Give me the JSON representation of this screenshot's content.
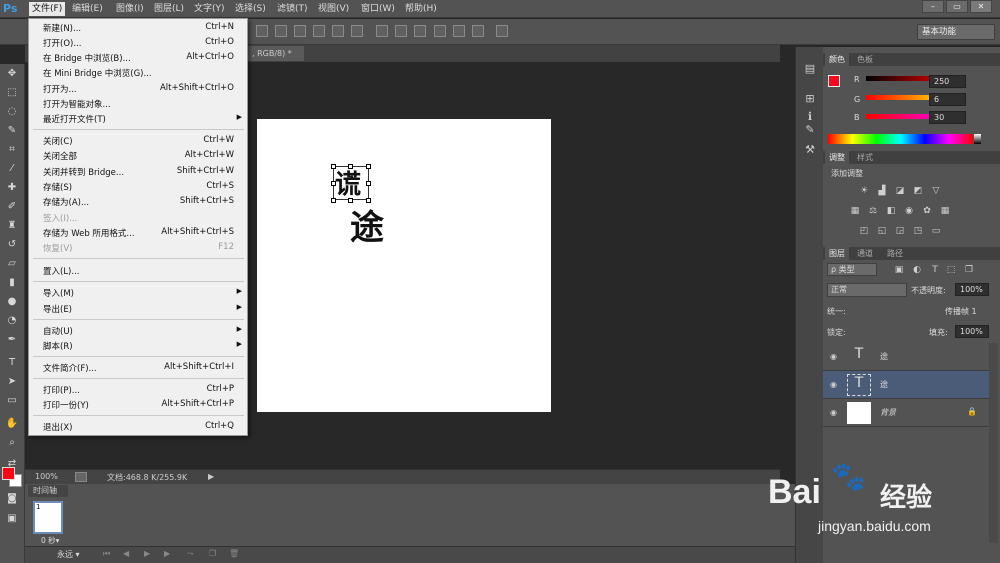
{
  "app": {
    "logo": "Ps"
  },
  "menubar": {
    "items": [
      "文件(F)",
      "编辑(E)",
      "图像(I)",
      "图层(L)",
      "文字(Y)",
      "选择(S)",
      "滤镜(T)",
      "视图(V)",
      "窗口(W)",
      "帮助(H)"
    ]
  },
  "window_controls": {
    "minimize": "–",
    "restore": "▭",
    "close": "✕"
  },
  "options_bar": {
    "workspace": "基本功能"
  },
  "document_tab": {
    "title": ", RGB/8) *",
    "close": "×"
  },
  "status": {
    "zoom": "100%",
    "doc_size": "文档:468.8 K/255.9K"
  },
  "timeline": {
    "header": "时间轴",
    "frame_number": "1",
    "frame_delay": "0 秒▾",
    "loop": "永远 ▾"
  },
  "file_menu": {
    "items": [
      {
        "label": "新建(N)...",
        "shortcut": "Ctrl+N"
      },
      {
        "label": "打开(O)...",
        "shortcut": "Ctrl+O"
      },
      {
        "label": "在 Bridge 中浏览(B)...",
        "shortcut": "Alt+Ctrl+O"
      },
      {
        "label": "在 Mini Bridge 中浏览(G)...",
        "shortcut": ""
      },
      {
        "label": "打开为...",
        "shortcut": "Alt+Shift+Ctrl+O"
      },
      {
        "label": "打开为智能对象...",
        "shortcut": ""
      },
      {
        "label": "最近打开文件(T)",
        "shortcut": "",
        "submenu": true
      },
      {
        "label": "关闭(C)",
        "shortcut": "Ctrl+W"
      },
      {
        "label": "关闭全部",
        "shortcut": "Alt+Ctrl+W"
      },
      {
        "label": "关闭并转到 Bridge...",
        "shortcut": "Shift+Ctrl+W"
      },
      {
        "label": "存储(S)",
        "shortcut": "Ctrl+S"
      },
      {
        "label": "存储为(A)...",
        "shortcut": "Shift+Ctrl+S"
      },
      {
        "label": "签入(I)...",
        "shortcut": "",
        "disabled": true
      },
      {
        "label": "存储为 Web 所用格式...",
        "shortcut": "Alt+Shift+Ctrl+S"
      },
      {
        "label": "恢复(V)",
        "shortcut": "F12",
        "disabled": true
      },
      {
        "label": "置入(L)...",
        "shortcut": ""
      },
      {
        "label": "导入(M)",
        "shortcut": "",
        "submenu": true
      },
      {
        "label": "导出(E)",
        "shortcut": "",
        "submenu": true
      },
      {
        "label": "自动(U)",
        "shortcut": "",
        "submenu": true
      },
      {
        "label": "脚本(R)",
        "shortcut": "",
        "submenu": true
      },
      {
        "label": "文件简介(F)...",
        "shortcut": "Alt+Shift+Ctrl+I"
      },
      {
        "label": "打印(P)...",
        "shortcut": "Ctrl+P"
      },
      {
        "label": "打印一份(Y)",
        "shortcut": "Alt+Shift+Ctrl+P"
      },
      {
        "label": "退出(X)",
        "shortcut": "Ctrl+Q"
      }
    ]
  },
  "color_panel": {
    "tabs": [
      "颜色",
      "色板"
    ],
    "r_label": "R",
    "g_label": "G",
    "b_label": "B",
    "r": "250",
    "g": "6",
    "b": "30",
    "fg_color": "#fa061e"
  },
  "adjust_panel": {
    "tabs": [
      "调整",
      "样式"
    ],
    "title": "添加调整"
  },
  "layers_panel": {
    "tabs": [
      "图层",
      "通道",
      "路径"
    ],
    "filter": "ρ 类型",
    "blend_mode": "正常",
    "opacity_label": "不透明度:",
    "opacity": "100%",
    "unify_label": "统一:",
    "propagate_label": "传播帧 1",
    "lock_label": "锁定:",
    "fill_label": "填充:",
    "fill": "100%",
    "layers": [
      {
        "name": "途",
        "thumb": "T"
      },
      {
        "name": "途",
        "thumb": "T"
      },
      {
        "name": "背景",
        "thumb": ""
      }
    ]
  },
  "canvas": {
    "glyph_top": "谎",
    "glyph_bottom": "途"
  },
  "watermark": {
    "brand": "Bai",
    "brand_suffix": "经验",
    "url": "jingyan.baidu.com"
  }
}
